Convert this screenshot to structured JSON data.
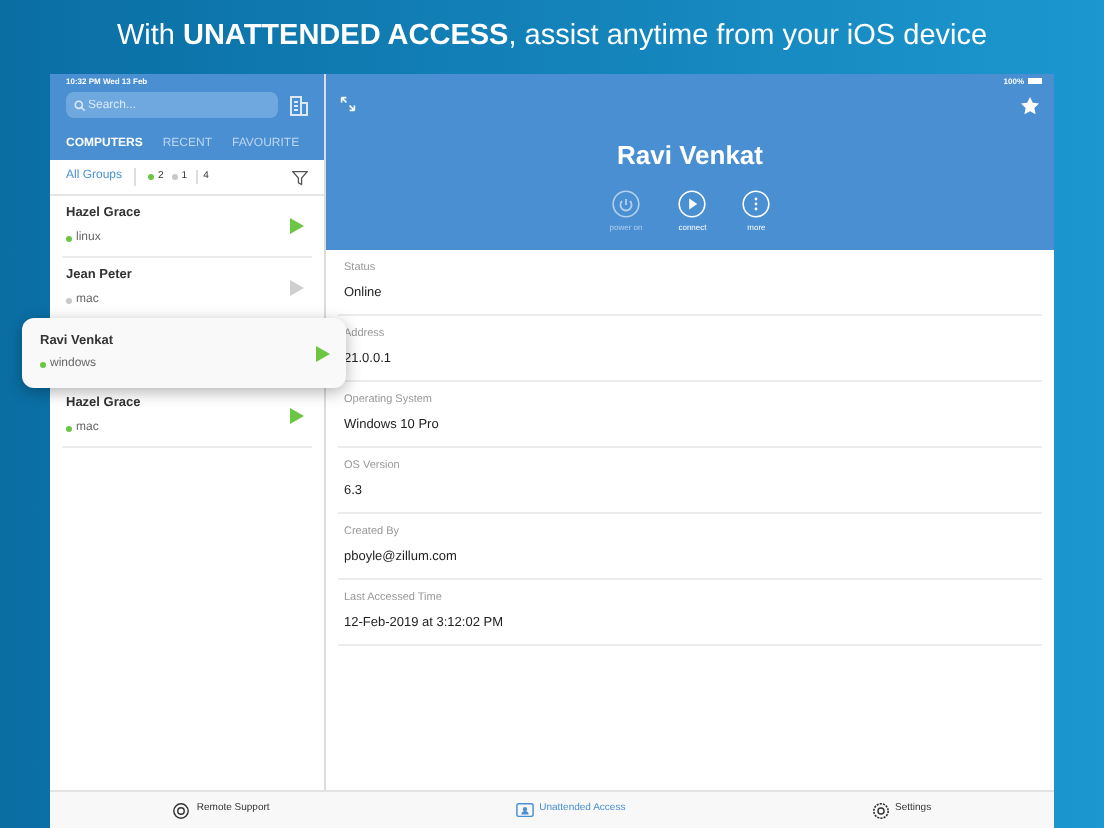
{
  "headline": "With **UNATTENDED ACCESS**, assist anytime from your iOS device",
  "status_bar": {
    "time": "10:32 PM  Wed 13 Feb",
    "battery": "100%"
  },
  "sidebar": {
    "search": {
      "placeholder": "Search..."
    },
    "tabs": [
      {
        "label": "COMPUTERS",
        "selected": true
      },
      {
        "label": "RECENT",
        "selected": false
      },
      {
        "label": "FAVOURITE",
        "selected": false
      }
    ],
    "filter": {
      "label": "All Groups",
      "online_count": "2",
      "offline_count": "1",
      "total": "4"
    },
    "items": [
      {
        "name": "Hazel Grace",
        "os": "linux",
        "online": true,
        "selected": false
      },
      {
        "name": "Jean Peter",
        "os": "mac",
        "online": false,
        "selected": false
      },
      {
        "name": "Ravi Venkat",
        "os": "windows",
        "online": true,
        "selected": true
      },
      {
        "name": "Hazel Grace",
        "os": "mac",
        "online": true,
        "selected": false
      }
    ]
  },
  "detail": {
    "title": "Ravi Venkat",
    "actions": [
      {
        "kind": "power",
        "label": "power on",
        "disabled": true
      },
      {
        "kind": "connect",
        "label": "connect",
        "disabled": false
      },
      {
        "kind": "more",
        "label": "more",
        "disabled": false
      }
    ],
    "fields": [
      {
        "label": "Status",
        "value": "Online"
      },
      {
        "label": "Address",
        "value": "21.0.0.1"
      },
      {
        "label": "Operating System",
        "value": "Windows 10 Pro"
      },
      {
        "label": "OS Version",
        "value": "6.3"
      },
      {
        "label": "Created By",
        "value": "pboyle@zillum.com"
      },
      {
        "label": "Last Accessed Time",
        "value": "12-Feb-2019 at 3:12:02 PM"
      }
    ]
  },
  "tab_bar": [
    {
      "kind": "support",
      "label": "Remote Support",
      "selected": false
    },
    {
      "kind": "unattended",
      "label": "Unattended Access",
      "selected": true
    },
    {
      "kind": "settings",
      "label": "Settings",
      "selected": false
    }
  ]
}
